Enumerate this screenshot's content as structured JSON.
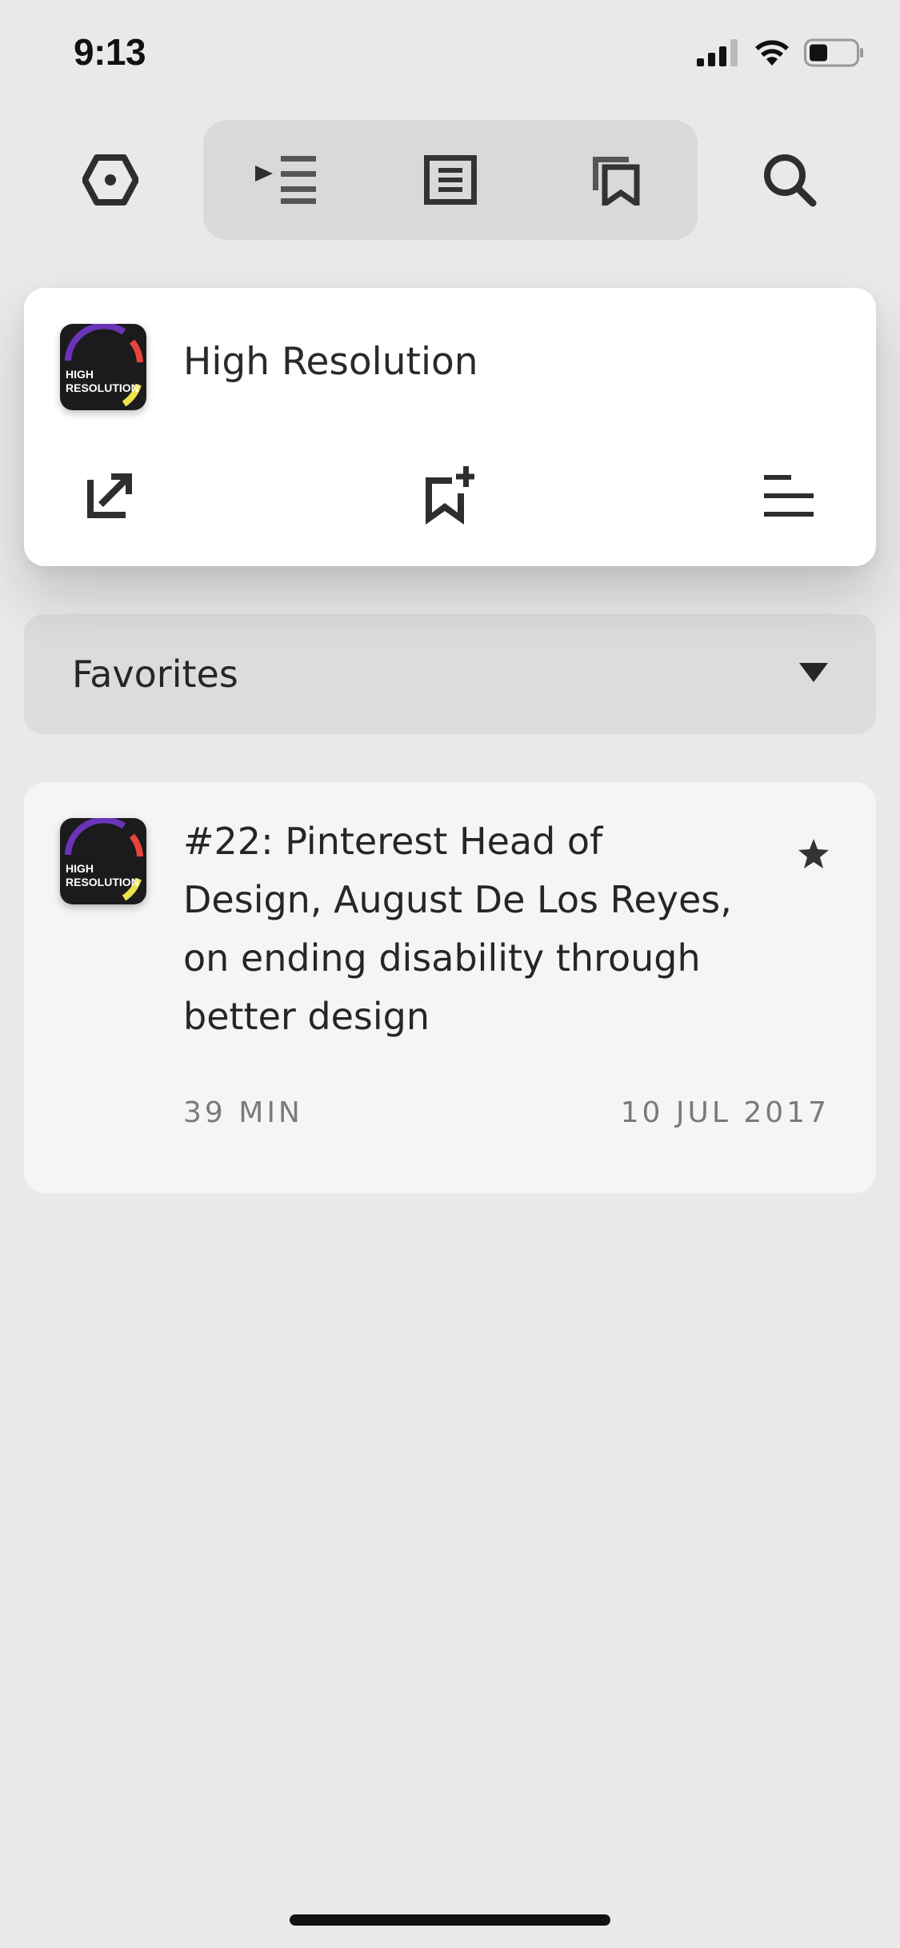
{
  "status_bar": {
    "time": "9:13",
    "icons": [
      "signal-icon",
      "wifi-icon",
      "battery-icon"
    ]
  },
  "toolbar": {
    "icons": [
      "settings-hexagon-icon",
      "queue-icon",
      "feed-list-icon",
      "bookmarks-icon",
      "search-icon"
    ]
  },
  "popup": {
    "podcast_title": "High Resolution",
    "artwork_text": [
      "HIGH",
      "RESOLUTION"
    ],
    "actions": [
      "share-icon",
      "add-bookmark-icon",
      "episode-list-icon"
    ]
  },
  "favorites": {
    "label": "Favorites"
  },
  "episode": {
    "title": "#22: Pinterest Head of Design, August De Los Reyes, on ending disability through better design",
    "duration": "39 MIN",
    "date": "10 JUL 2017",
    "starred": true
  },
  "colors": {
    "background": "#e9e9e9",
    "card": "#ffffff",
    "episode_card": "#f5f5f5",
    "segmented": "#d9d9d9",
    "icon": "#2e2e2e",
    "art_purple": "#6a34b8",
    "art_red": "#e8443a",
    "art_yellow": "#e9e44a"
  }
}
